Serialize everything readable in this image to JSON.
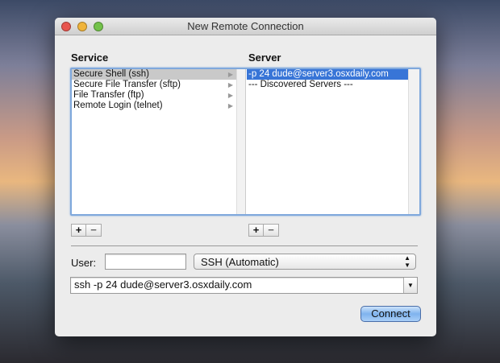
{
  "window": {
    "title": "New Remote Connection"
  },
  "service": {
    "header": "Service",
    "items": [
      "Secure Shell (ssh)",
      "Secure File Transfer (sftp)",
      "File Transfer (ftp)",
      "Remote Login (telnet)"
    ]
  },
  "server": {
    "header": "Server",
    "items": [
      "-p 24 dude@server3.osxdaily.com",
      "--- Discovered Servers ---"
    ]
  },
  "buttons": {
    "add": "+",
    "remove": "−",
    "connect": "Connect"
  },
  "user": {
    "label": "User:",
    "value": ""
  },
  "protocol": {
    "selected": "SSH (Automatic)"
  },
  "command": {
    "value": "ssh -p 24 dude@server3.osxdaily.com"
  }
}
